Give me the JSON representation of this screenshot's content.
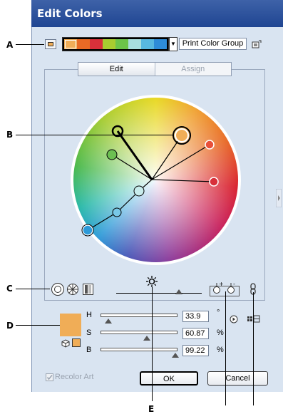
{
  "dialog": {
    "title": "Edit Colors"
  },
  "callouts": {
    "a": "A",
    "b": "B",
    "c": "C",
    "d": "D",
    "e": "E"
  },
  "header": {
    "group_name": "Print Color Group",
    "group_colors": [
      "#f0ad57",
      "#e86a25",
      "#d8303a",
      "#a8cc30",
      "#6cc44a",
      "#a8dede",
      "#58b8e0",
      "#2e8cd8"
    ]
  },
  "tabs": [
    {
      "label": "Edit"
    },
    {
      "label": "Assign"
    }
  ],
  "sliders": {
    "h": {
      "label": "H",
      "value": "33.9",
      "unit": "°"
    },
    "s": {
      "label": "S",
      "value": "60.87",
      "unit": "%"
    },
    "b": {
      "label": "B",
      "value": "99.22",
      "unit": "%"
    }
  },
  "active_color": "#f0ad57",
  "footer": {
    "recolor_label": "Recolor Art",
    "ok_label": "OK",
    "cancel_label": "Cancel"
  }
}
